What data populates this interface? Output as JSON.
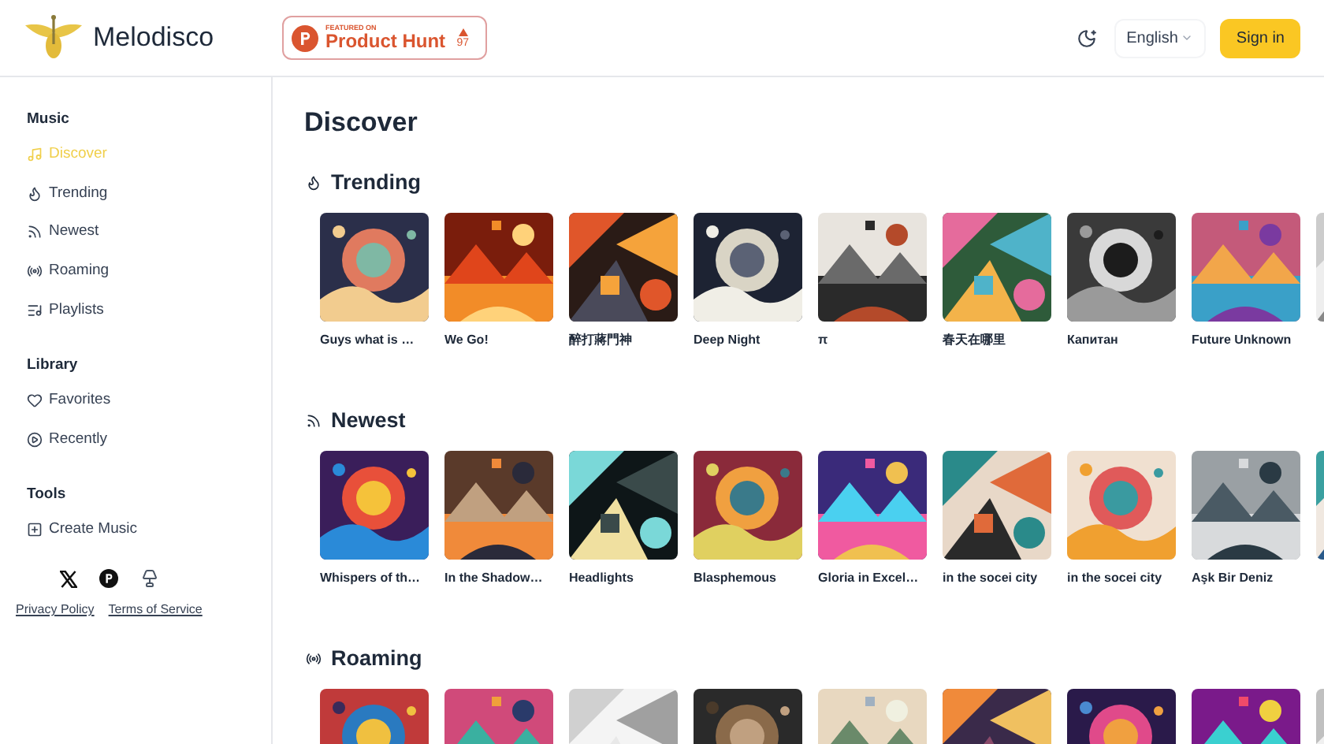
{
  "header": {
    "brand": "Melodisco",
    "badge": {
      "caption": "FEATURED ON",
      "name": "Product Hunt",
      "votes": "97"
    },
    "language": "English",
    "sign_in": "Sign in"
  },
  "sidebar": {
    "groups": [
      {
        "title": "Music",
        "items": [
          {
            "label": "Discover",
            "kind": "music",
            "selected": true
          },
          {
            "label": "Trending",
            "kind": "flame",
            "selected": false
          },
          {
            "label": "Newest",
            "kind": "rss",
            "selected": false
          },
          {
            "label": "Roaming",
            "kind": "radio",
            "selected": false
          },
          {
            "label": "Playlists",
            "kind": "list",
            "selected": false
          }
        ]
      },
      {
        "title": "Library",
        "items": [
          {
            "label": "Favorites",
            "kind": "heart",
            "selected": false
          },
          {
            "label": "Recently",
            "kind": "play",
            "selected": false
          }
        ]
      },
      {
        "title": "Tools",
        "items": [
          {
            "label": "Create Music",
            "kind": "create",
            "selected": false
          }
        ]
      }
    ],
    "links": [
      "Privacy Policy",
      "Terms of Service"
    ]
  },
  "page_title": "Discover",
  "sections": [
    {
      "title": "Trending",
      "kind": "flame",
      "songs": [
        {
          "kind": "picture",
          "title": "Guys what is …"
        },
        {
          "kind": "picture",
          "title": "We Go!"
        },
        {
          "kind": "picture",
          "title": "醉打蔣門神"
        },
        {
          "kind": "picture",
          "title": "Deep Night"
        },
        {
          "kind": "picture",
          "title": "π"
        },
        {
          "kind": "picture",
          "title": "春天在哪里"
        },
        {
          "kind": "picture",
          "title": "Капитан"
        },
        {
          "kind": "picture",
          "title": "Future Unknown"
        },
        {
          "kind": "picture"
        }
      ]
    },
    {
      "title": "Newest",
      "kind": "rss",
      "songs": [
        {
          "kind": "picture",
          "title": "Whispers of th…"
        },
        {
          "kind": "picture",
          "title": "In the Shadow…"
        },
        {
          "kind": "picture",
          "title": "Headlights"
        },
        {
          "kind": "picture",
          "title": "Blasphemous"
        },
        {
          "kind": "picture",
          "title": "Gloria in Excel…"
        },
        {
          "kind": "picture",
          "title": "in the socei city"
        },
        {
          "kind": "picture",
          "title": "in the socei city"
        },
        {
          "kind": "picture",
          "title": "Aşk Bir Deniz"
        },
        {
          "kind": "picture"
        }
      ]
    },
    {
      "title": "Roaming",
      "kind": "radio",
      "songs": [
        {
          "kind": "picture"
        },
        {
          "kind": "picture"
        },
        {
          "kind": "picture"
        },
        {
          "kind": "picture"
        },
        {
          "kind": "picture"
        },
        {
          "kind": "picture"
        },
        {
          "kind": "picture"
        },
        {
          "kind": "picture"
        },
        {
          "kind": "picture"
        }
      ]
    }
  ]
}
